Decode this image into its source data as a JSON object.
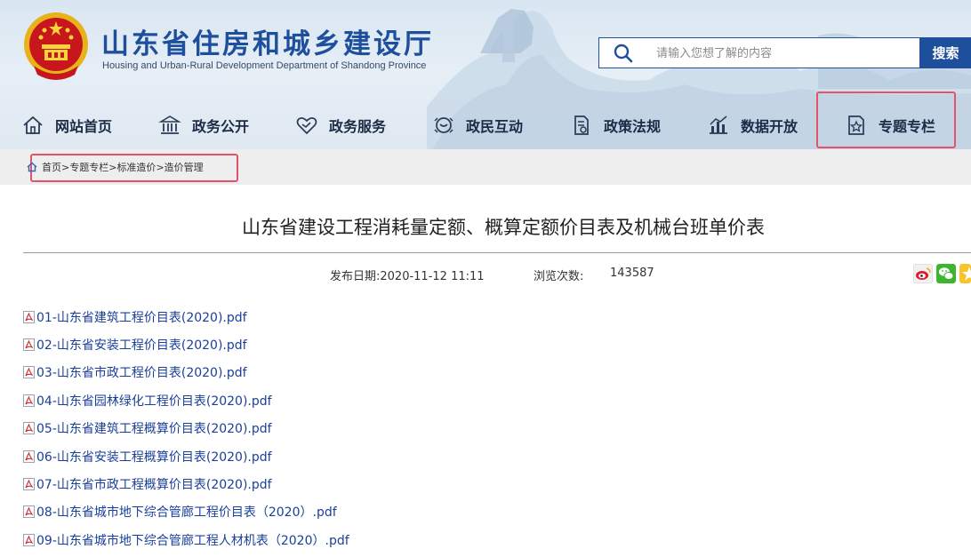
{
  "header": {
    "site_title": "山东省住房和城乡建设厅",
    "site_subtitle": "Housing and Urban-Rural Development Department of Shandong Province",
    "brand_color": "#1d4f9c"
  },
  "search": {
    "placeholder": "请输入您想了解的内容",
    "button_label": "搜索"
  },
  "nav": {
    "items": [
      {
        "label": "网站首页",
        "icon": "home-icon"
      },
      {
        "label": "政务公开",
        "icon": "government-building-icon"
      },
      {
        "label": "政务服务",
        "icon": "handshake-heart-icon"
      },
      {
        "label": "政民互动",
        "icon": "chat-interaction-icon"
      },
      {
        "label": "政策法规",
        "icon": "document-seal-icon"
      },
      {
        "label": "数据开放",
        "icon": "bar-chart-icon"
      },
      {
        "label": "专题专栏",
        "icon": "star-page-icon",
        "highlighted": true
      }
    ]
  },
  "breadcrumb": {
    "items": [
      "首页",
      "专题专栏",
      "标准造价",
      "造价管理"
    ],
    "separator": ">"
  },
  "article": {
    "title": "山东省建设工程消耗量定额、概算定额价目表及机械台班单价表",
    "publish_label": "发布日期:",
    "publish_date": "2020-11-12 11:11",
    "views_label": "浏览次数:",
    "views": "143587",
    "files": [
      "01-山东省建筑工程价目表(2020).pdf",
      "02-山东省安装工程价目表(2020).pdf",
      "03-山东省市政工程价目表(2020).pdf",
      "04-山东省园林绿化工程价目表(2020).pdf",
      "05-山东省建筑工程概算价目表(2020).pdf",
      "06-山东省安装工程概算价目表(2020).pdf",
      "07-山东省市政工程概算价目表(2020).pdf",
      "08-山东省城市地下综合管廊工程价目表（2020）.pdf",
      "09-山东省城市地下综合管廊工程人材机表（2020）.pdf"
    ]
  },
  "share": {
    "icons": [
      "weibo-icon",
      "wechat-icon",
      "qzone-star-icon"
    ]
  },
  "colors": {
    "highlight_box": "#e3536b",
    "link": "#1a3f9a",
    "crumb_bg": "#eeeeee"
  }
}
